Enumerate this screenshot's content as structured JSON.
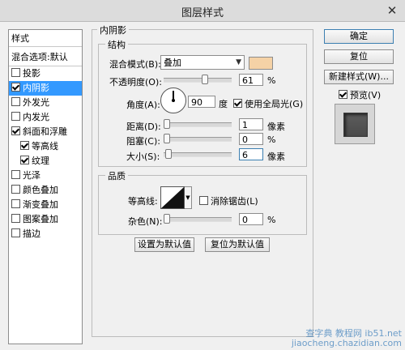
{
  "window": {
    "title": "图层样式",
    "close_symbol": "✕"
  },
  "sidebar": {
    "header": "样式",
    "blend_options": "混合选项:默认",
    "items": [
      {
        "label": "投影",
        "checked": false,
        "sub": false,
        "selected": false
      },
      {
        "label": "内阴影",
        "checked": true,
        "sub": false,
        "selected": true
      },
      {
        "label": "外发光",
        "checked": false,
        "sub": false,
        "selected": false
      },
      {
        "label": "内发光",
        "checked": false,
        "sub": false,
        "selected": false
      },
      {
        "label": "斜面和浮雕",
        "checked": true,
        "sub": false,
        "selected": false
      },
      {
        "label": "等高线",
        "checked": true,
        "sub": true,
        "selected": false
      },
      {
        "label": "纹理",
        "checked": true,
        "sub": true,
        "selected": false
      },
      {
        "label": "光泽",
        "checked": false,
        "sub": false,
        "selected": false
      },
      {
        "label": "颜色叠加",
        "checked": false,
        "sub": false,
        "selected": false
      },
      {
        "label": "渐变叠加",
        "checked": false,
        "sub": false,
        "selected": false
      },
      {
        "label": "图案叠加",
        "checked": false,
        "sub": false,
        "selected": false
      },
      {
        "label": "描边",
        "checked": false,
        "sub": false,
        "selected": false
      }
    ]
  },
  "panel": {
    "title": "内阴影",
    "structure": {
      "label": "结构",
      "blend_mode_label": "混合模式(B):",
      "blend_mode_value": "叠加",
      "blend_color": "#f5d2a6",
      "opacity_label": "不透明度(O):",
      "opacity_value": "61",
      "opacity_unit": "%",
      "opacity_fraction": 0.61,
      "angle_label": "角度(A):",
      "angle_value": "90",
      "angle_unit": "度",
      "global_light_label": "使用全局光(G)",
      "global_light_checked": true,
      "distance_label": "距离(D):",
      "distance_value": "1",
      "distance_unit": "像素",
      "choke_label": "阻塞(C):",
      "choke_value": "0",
      "choke_unit": "%",
      "size_label": "大小(S):",
      "size_value": "6",
      "size_unit": "像素"
    },
    "quality": {
      "label": "品质",
      "contour_label": "等高线:",
      "antialias_label": "消除锯齿(L)",
      "antialias_checked": false,
      "noise_label": "杂色(N):",
      "noise_value": "0",
      "noise_unit": "%"
    },
    "make_default": "设置为默认值",
    "reset_default": "复位为默认值"
  },
  "buttons": {
    "ok": "确定",
    "reset": "复位",
    "new_style": "新建样式(W)...",
    "preview_label": "预览(V)",
    "preview_checked": true
  },
  "watermark": {
    "line1": "查字典 教程网 ib51.net",
    "line2": "jiaocheng.chazidian.com"
  }
}
